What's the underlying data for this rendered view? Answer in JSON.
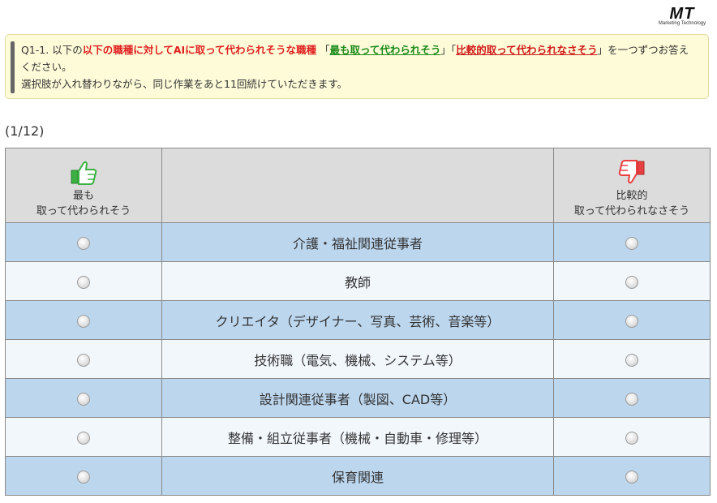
{
  "logo": {
    "text": "MT",
    "subtext": "Marketing Technology"
  },
  "question": {
    "prefix": "Q1-1. 以下の",
    "emphasis": "以下の職種に対してAIに取って代わられそうな職種",
    "open1": "「",
    "best_label": "最も取って代わられそう",
    "mid": "」「",
    "worst_label": "比較的取って代わられなさそう",
    "suffix": "」を一つずつお答えください。",
    "line2": "選択肢が入れ替わりながら、同じ作業をあと11回続けていただきます。"
  },
  "counter": "(1/12)",
  "header": {
    "left_line1": "最も",
    "left_line2": "取って代わられそう",
    "right_line1": "比較的",
    "right_line2": "取って代わられなさそう"
  },
  "colors": {
    "thumb_up": "#3cb043",
    "thumb_down": "#e84040"
  },
  "rows": [
    {
      "label": "介護・福祉関連従事者"
    },
    {
      "label": "教師"
    },
    {
      "label": "クリエイタ（デザイナー、写真、芸術、音楽等）"
    },
    {
      "label": "技術職（電気、機械、システム等）"
    },
    {
      "label": "設計関連従事者（製図、CAD等）"
    },
    {
      "label": "整備・組立従事者（機械・自動車・修理等）"
    },
    {
      "label": "保育関連"
    }
  ]
}
